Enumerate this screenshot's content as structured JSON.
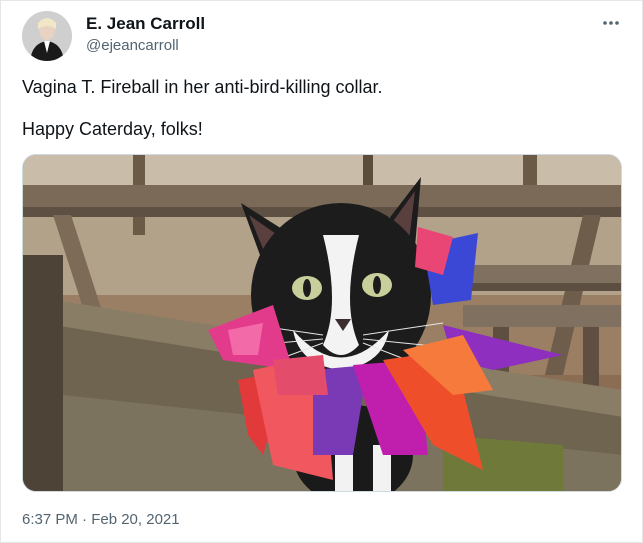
{
  "author": {
    "display_name": "E. Jean Carroll",
    "handle": "@ejeancarroll"
  },
  "tweet": {
    "line1": "Vagina T. Fireball in her anti-bird-killing collar.",
    "line2": "Happy Caterday, folks!",
    "timestamp": "6:37 PM · Feb 20, 2021"
  },
  "icons": {
    "more": "more-dots-icon"
  },
  "colors": {
    "text": "#0f1419",
    "secondary": "#536471",
    "border": "#cfd9de"
  }
}
